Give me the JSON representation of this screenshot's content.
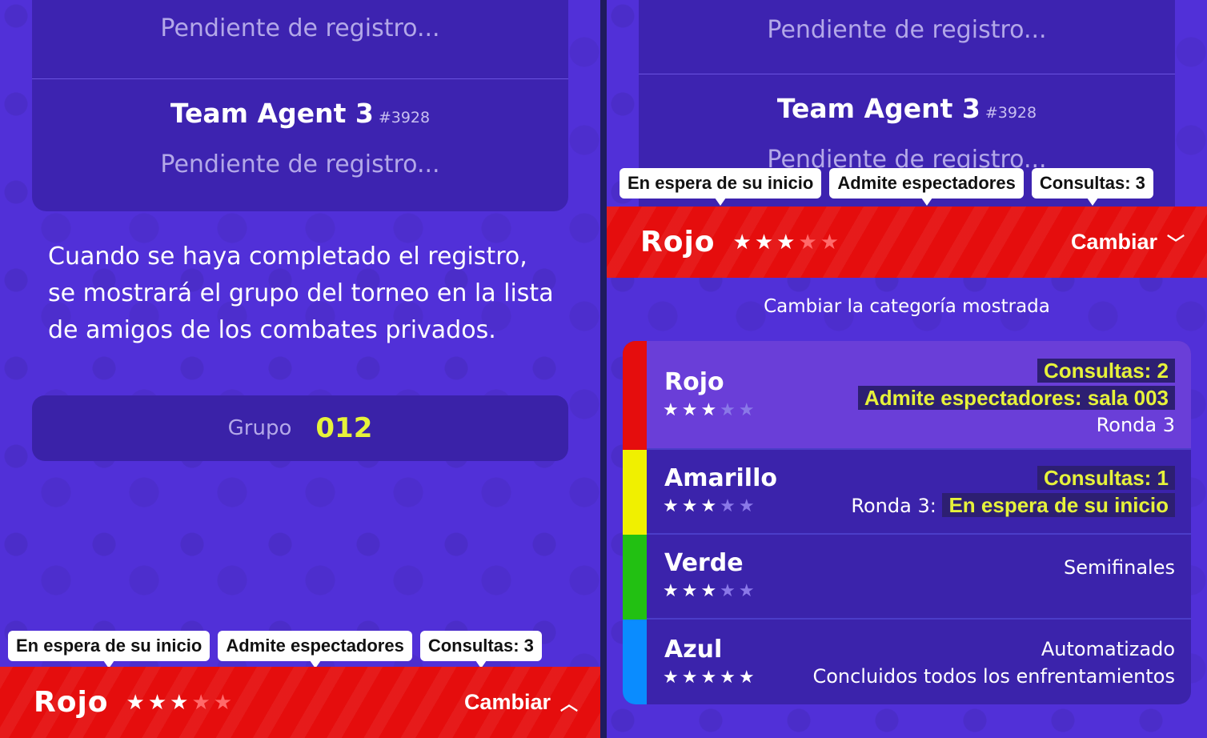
{
  "left": {
    "pending_top": "Pendiente de registro...",
    "team": {
      "name": "Team Agent 3",
      "tag": "#3928",
      "status": "Pendiente de registro..."
    },
    "info": "Cuando se haya completado el registro, se mostrará el grupo del torneo en la lista de amigos de los combates privados.",
    "group": {
      "label": "Grupo",
      "value": "012"
    },
    "tags": [
      "En espera de su inicio",
      "Admite espectadores",
      "Consultas: 3"
    ],
    "bar": {
      "title": "Rojo",
      "stars_on": 3,
      "stars_total": 5,
      "action": "Cambiar",
      "chevron": "chevron-up-icon"
    }
  },
  "right": {
    "pending_top": "Pendiente de registro...",
    "team": {
      "name": "Team Agent 3",
      "tag": "#3928",
      "status": "Pendiente de registro..."
    },
    "tags": [
      "En espera de su inicio",
      "Admite espectadores",
      "Consultas: 3"
    ],
    "bar": {
      "title": "Rojo",
      "stars_on": 3,
      "stars_total": 5,
      "action": "Cambiar",
      "chevron": "chevron-down-icon"
    },
    "caption": "Cambiar la categoría mostrada",
    "categories": [
      {
        "name": "Rojo",
        "color": "#e50d0d",
        "stars_on": 3,
        "consultas": "Consultas: 2",
        "espectadores": "Admite espectadores: sala 003",
        "ronda": "Ronda 3"
      },
      {
        "name": "Amarillo",
        "color": "#f0f000",
        "stars_on": 3,
        "consultas": "Consultas: 1",
        "ronda_label": "Ronda 3:",
        "ronda_status": "En espera de su inicio"
      },
      {
        "name": "Verde",
        "color": "#22c012",
        "stars_on": 3,
        "status": "Semifinales"
      },
      {
        "name": "Azul",
        "color": "#0a8cff",
        "stars_on": 5,
        "mode": "Automatizado",
        "status": "Concluidos todos los enfrentamientos"
      }
    ]
  },
  "colors": {
    "background": "#5130d8",
    "card": "#3d23b0",
    "accent_yellow": "#e6f23a",
    "bar_red": "#e50d0d"
  }
}
